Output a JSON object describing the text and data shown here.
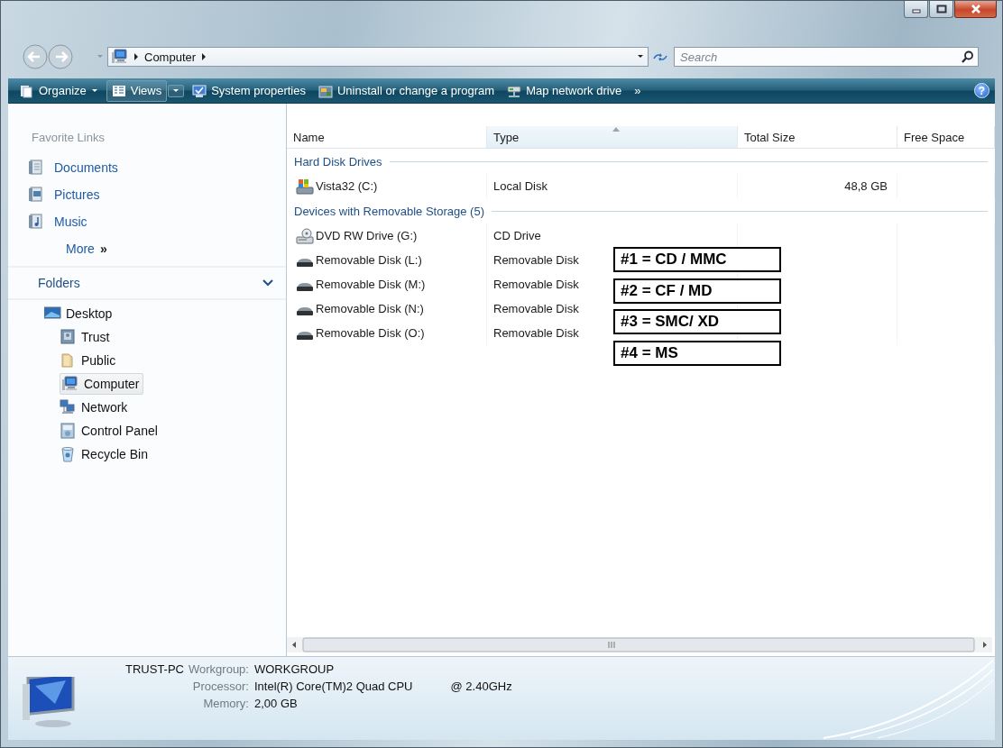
{
  "address": {
    "path": [
      "Computer"
    ],
    "search_placeholder": "Search"
  },
  "toolbar": {
    "items": [
      {
        "kind": "menu",
        "label": "Organize"
      },
      {
        "kind": "split",
        "label": "Views"
      },
      {
        "kind": "plain",
        "label": "System properties"
      },
      {
        "kind": "plain",
        "label": "Uninstall or change a program"
      },
      {
        "kind": "plain",
        "label": "Map network drive"
      },
      {
        "kind": "more",
        "label": "»"
      }
    ],
    "help": "?"
  },
  "sidebar": {
    "favorites_title": "Favorite Links",
    "favorites": [
      {
        "label": "Documents",
        "kind": "documents"
      },
      {
        "label": "Pictures",
        "kind": "pictures"
      },
      {
        "label": "Music",
        "kind": "music"
      }
    ],
    "more": {
      "label": "More",
      "arrow": "»"
    },
    "folders": {
      "title": "Folders",
      "expanded": true,
      "tree": [
        {
          "label": "Desktop",
          "kind": "desktop",
          "selected": false,
          "children": [
            {
              "label": "Trust",
              "kind": "user",
              "selected": false
            },
            {
              "label": "Public",
              "kind": "folder",
              "selected": false
            },
            {
              "label": "Computer",
              "kind": "computer",
              "selected": true
            },
            {
              "label": "Network",
              "kind": "network",
              "selected": false
            },
            {
              "label": "Control Panel",
              "kind": "control-panel",
              "selected": false
            },
            {
              "label": "Recycle Bin",
              "kind": "recycle-bin",
              "selected": false
            }
          ]
        }
      ]
    }
  },
  "table": {
    "columns": [
      {
        "label": "Name",
        "sorted": false
      },
      {
        "label": "Type",
        "sorted": true
      },
      {
        "label": "Total Size",
        "sorted": false
      },
      {
        "label": "Free Space",
        "sorted": false
      }
    ],
    "groups": [
      {
        "title": "Hard Disk Drives",
        "rows": [
          {
            "kind": "hdd",
            "name": "Vista32 (C:)",
            "type": "Local Disk",
            "total_size": "48,8 GB"
          }
        ]
      },
      {
        "title": "Devices with Removable Storage (5)",
        "rows": [
          {
            "kind": "dvd",
            "name": "DVD RW Drive (G:)",
            "type": "CD Drive"
          },
          {
            "kind": "removable",
            "name": "Removable Disk (L:)",
            "type": "Removable Disk"
          },
          {
            "kind": "removable",
            "name": "Removable Disk (M:)",
            "type": "Removable Disk"
          },
          {
            "kind": "removable",
            "name": "Removable Disk (N:)",
            "type": "Removable Disk"
          },
          {
            "kind": "removable",
            "name": "Removable Disk (O:)",
            "type": "Removable Disk"
          }
        ]
      }
    ]
  },
  "annotations": [
    "#1 = CD / MMC",
    "#2 = CF / MD",
    "#3 = SMC/ XD",
    "#4 = MS"
  ],
  "details": {
    "computer_name": "TRUST-PC",
    "fields": [
      {
        "label": "Workgroup:",
        "value": "WORKGROUP"
      },
      {
        "label": "Processor:",
        "value": "Intel(R) Core(TM)2 Quad CPU",
        "extra": "@ 2.40GHz"
      },
      {
        "label": "Memory:",
        "value": "2,00 GB"
      }
    ]
  }
}
